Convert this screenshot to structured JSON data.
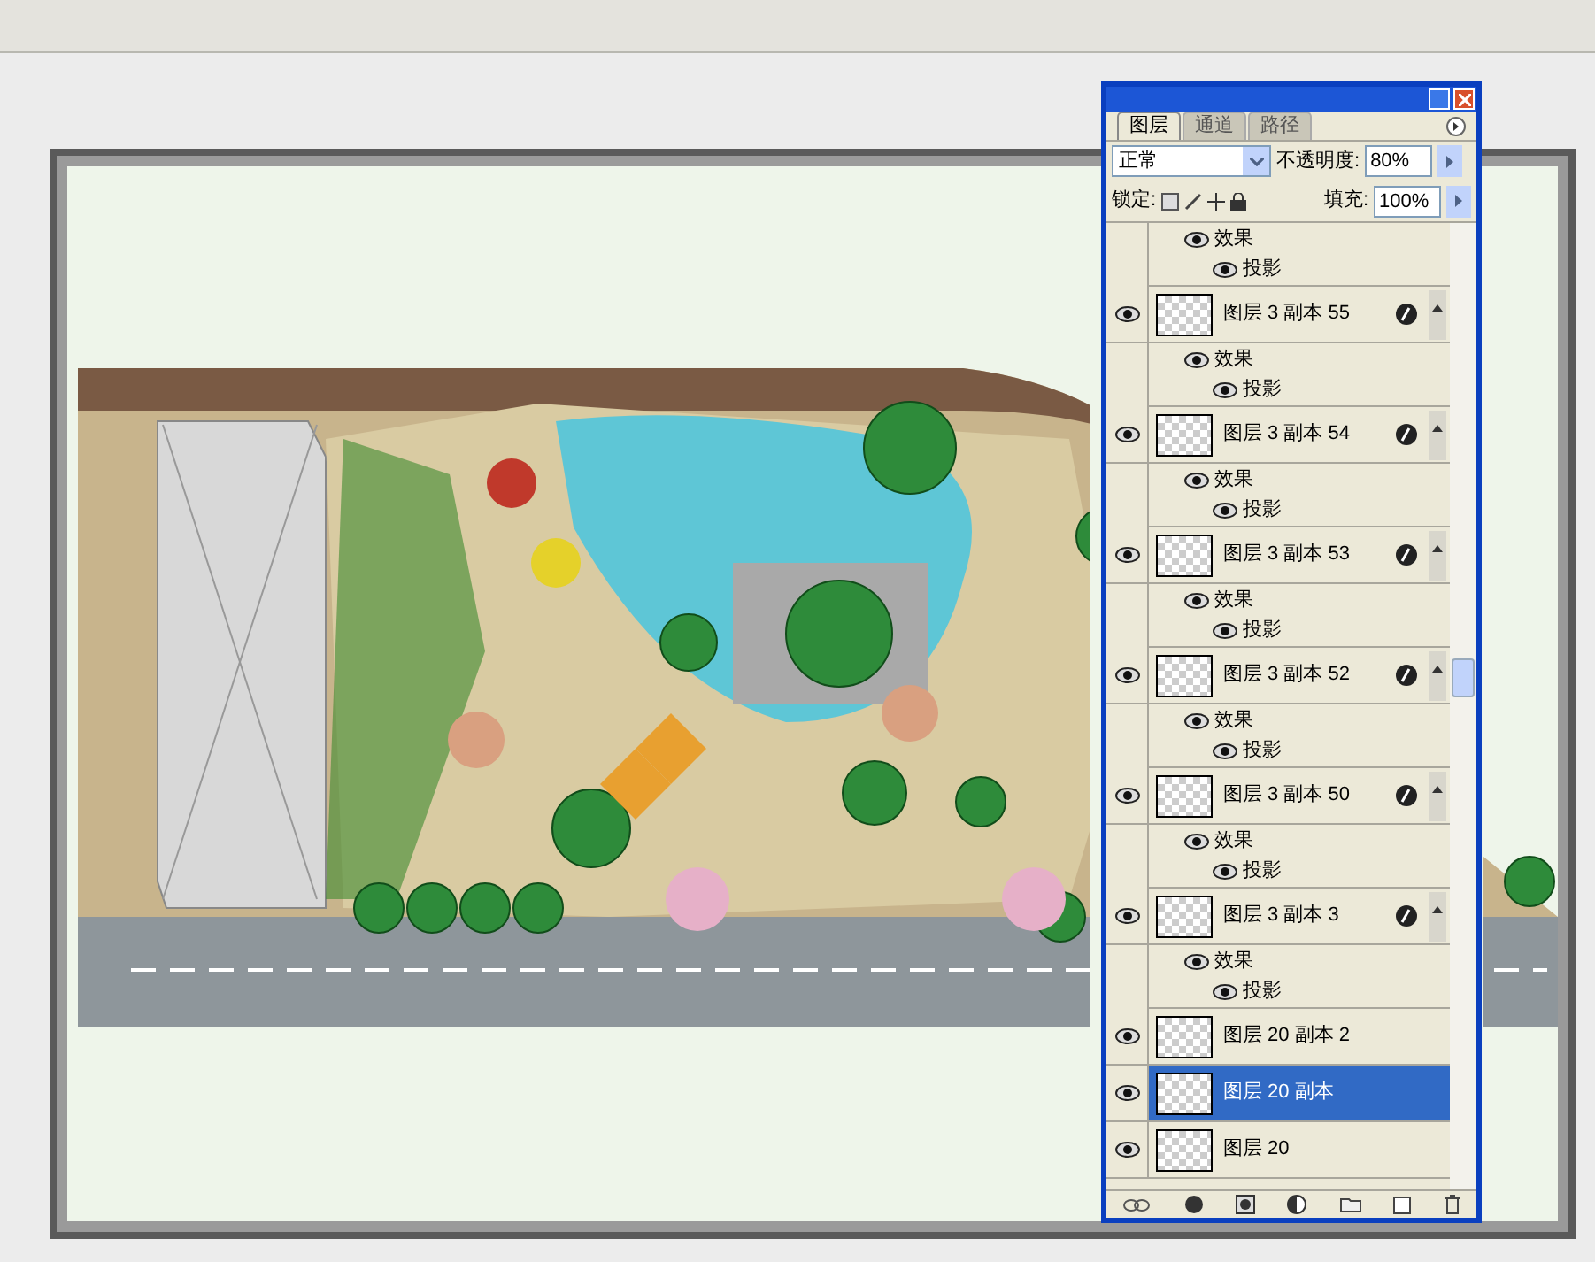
{
  "panel": {
    "tabs": [
      {
        "label": "图层",
        "selected": true
      },
      {
        "label": "通道",
        "selected": false
      },
      {
        "label": "路径",
        "selected": false
      }
    ],
    "blend_mode": "正常",
    "opacity_label": "不透明度:",
    "opacity": "80%",
    "lock_label": "锁定:",
    "fill_label": "填充:",
    "fill": "100%",
    "rows": [
      {
        "kind": "effects",
        "label": "效果",
        "visible": true
      },
      {
        "kind": "effect",
        "label": "投影",
        "visible": true
      },
      {
        "kind": "layer",
        "label": "图层 3 副本 55",
        "visible": true,
        "selected": false,
        "fx": true
      },
      {
        "kind": "effects",
        "label": "效果",
        "visible": true
      },
      {
        "kind": "effect",
        "label": "投影",
        "visible": true
      },
      {
        "kind": "layer",
        "label": "图层 3 副本 54",
        "visible": true,
        "selected": false,
        "fx": true
      },
      {
        "kind": "effects",
        "label": "效果",
        "visible": true
      },
      {
        "kind": "effect",
        "label": "投影",
        "visible": true
      },
      {
        "kind": "layer",
        "label": "图层 3 副本 53",
        "visible": true,
        "selected": false,
        "fx": true
      },
      {
        "kind": "effects",
        "label": "效果",
        "visible": true
      },
      {
        "kind": "effect",
        "label": "投影",
        "visible": true
      },
      {
        "kind": "layer",
        "label": "图层 3 副本 52",
        "visible": true,
        "selected": false,
        "fx": true
      },
      {
        "kind": "effects",
        "label": "效果",
        "visible": true
      },
      {
        "kind": "effect",
        "label": "投影",
        "visible": true
      },
      {
        "kind": "layer",
        "label": "图层 3 副本 50",
        "visible": true,
        "selected": false,
        "fx": true
      },
      {
        "kind": "effects",
        "label": "效果",
        "visible": true
      },
      {
        "kind": "effect",
        "label": "投影",
        "visible": true
      },
      {
        "kind": "layer",
        "label": "图层 3 副本 3",
        "visible": true,
        "selected": false,
        "fx": true
      },
      {
        "kind": "effects",
        "label": "效果",
        "visible": true
      },
      {
        "kind": "effect",
        "label": "投影",
        "visible": true
      },
      {
        "kind": "layer",
        "label": "图层 20 副本 2",
        "visible": true,
        "selected": false,
        "fx": false
      },
      {
        "kind": "layer",
        "label": "图层 20 副本",
        "visible": true,
        "selected": true,
        "fx": false
      },
      {
        "kind": "layer",
        "label": "图层 20",
        "visible": true,
        "selected": false,
        "fx": false
      }
    ]
  }
}
